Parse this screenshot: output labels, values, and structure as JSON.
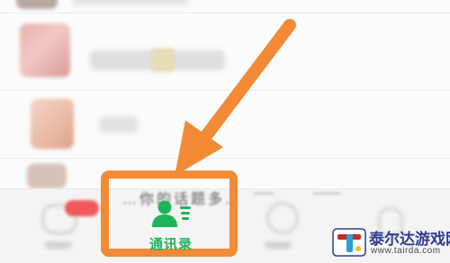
{
  "tabbar": {
    "active_tab": {
      "label": "通讯录",
      "icon": "contacts-icon",
      "color": "#1fb35a"
    },
    "inactive_tabs": [
      {
        "icon": "chat-icon"
      },
      {
        "icon": "discover-icon"
      },
      {
        "icon": "me-icon"
      }
    ]
  },
  "banner": {
    "text": "…你的话题多…"
  },
  "annotation": {
    "color": "#f28a36",
    "arrow_icon": "arrow-icon"
  },
  "watermark": {
    "title": "泰尔达游戏网",
    "url": "www.tairda.com",
    "logo_colors": [
      "#c62b2b",
      "#2aa0d8",
      "#f2c21a"
    ]
  }
}
